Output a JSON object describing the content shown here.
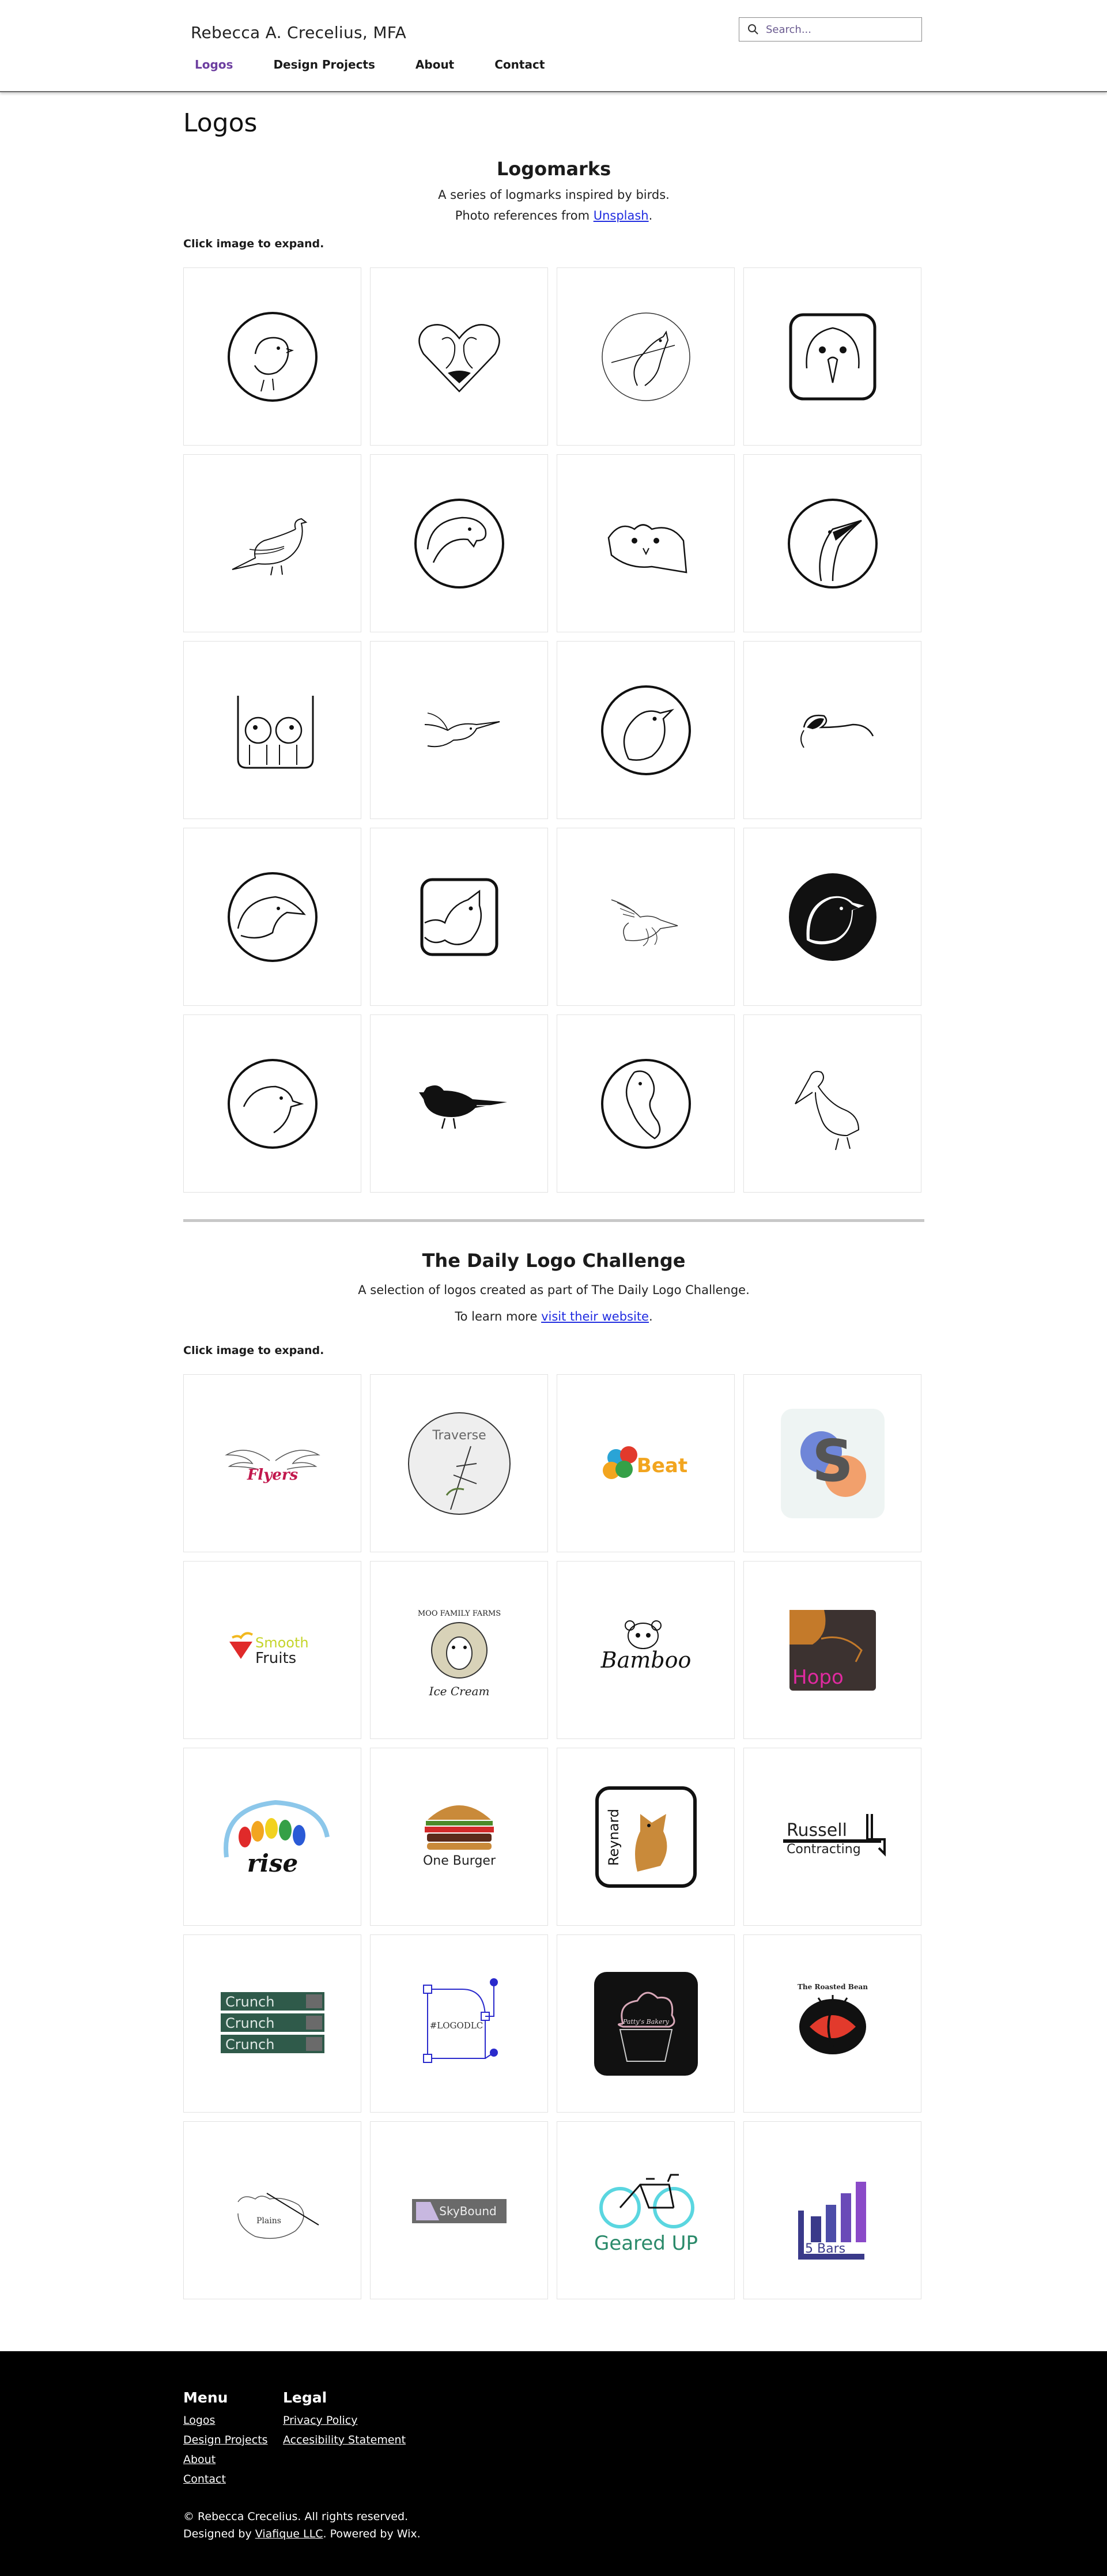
{
  "header": {
    "site_title": "Rebecca A. Crecelius, MFA",
    "search_placeholder": "Search...",
    "nav": [
      "Logos",
      "Design Projects",
      "About",
      "Contact"
    ]
  },
  "page": {
    "title": "Logos"
  },
  "logomarks": {
    "title": "Logomarks",
    "subtitle": "A series of logmarks inspired by birds.",
    "photo_ref_prefix": "Photo references from ",
    "photo_ref_link": "Unsplash",
    "photo_ref_suffix": ".",
    "click_hint": "Click image to expand."
  },
  "daily": {
    "title": "The Daily Logo Challenge",
    "subtitle": "A selection of logos created as part of The Daily Logo Challenge.",
    "learn_prefix": "To learn more ",
    "learn_link": "visit their website",
    "learn_suffix": ".",
    "click_hint": "Click image to expand.",
    "logo_texts": {
      "flyers": "Flyers",
      "traverse": "Traverse",
      "beat": "Beat",
      "smooth": "Smooth",
      "fruits": "Fruits",
      "moo": "MOO FAMILY FARMS",
      "ice_cream": "Ice Cream",
      "bamboo": "Bamboo",
      "hopo": "Hopo",
      "rise": "rise",
      "one_burger": "One Burger",
      "reynard": "Reynard",
      "russell": "Russell",
      "contracting": "Contracting",
      "crunch": "Crunch",
      "logodlc": "#LOGODLC",
      "bakery": "Patty's Bakery",
      "roasted_bean": "The Roasted Bean",
      "plains": "Plains",
      "skybound": "SkyBound",
      "geared": "Geared UP",
      "bars": "5 Bars"
    }
  },
  "footer": {
    "menu_title": "Menu",
    "menu": [
      "Logos",
      "Design Projects",
      "About",
      "Contact"
    ],
    "legal_title": "Legal",
    "legal": [
      "Privacy Policy",
      "Accesibility Statement"
    ],
    "copyright": "© Rebecca Crecelius. All rights reserved.",
    "designed_prefix": "Designed by ",
    "designed_link": "Viafique LLC",
    "designed_suffix": ". Powered by Wix."
  },
  "colors": {
    "accent": "#6d3fa0",
    "link": "#1f2be0",
    "footer_bg": "#000000"
  }
}
